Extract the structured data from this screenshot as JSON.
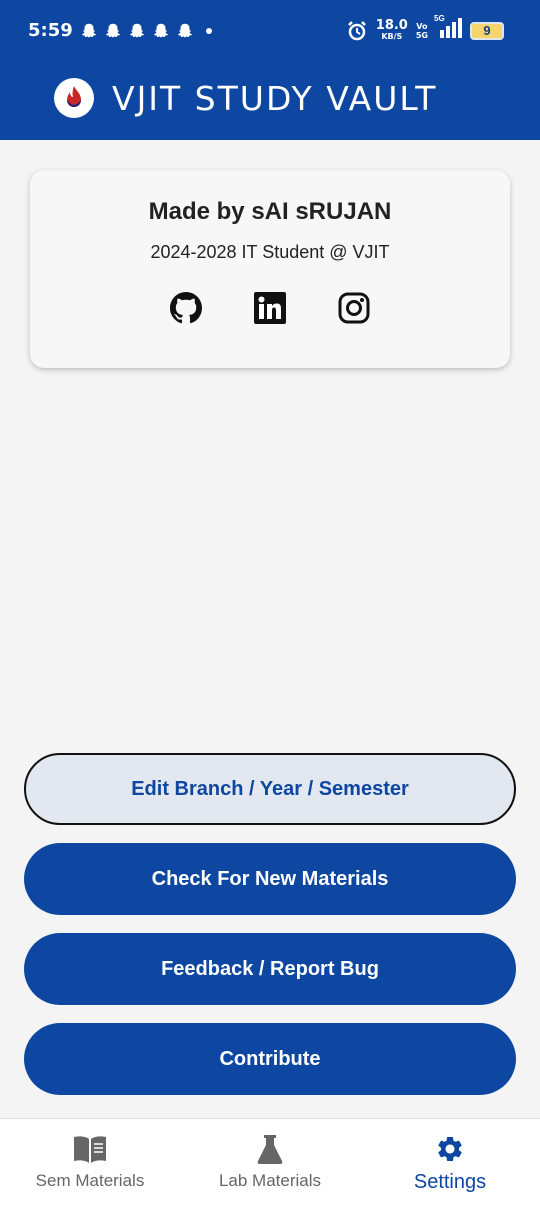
{
  "status_bar": {
    "time": "5:59",
    "net_speed": "18.0",
    "net_unit": "KB/S",
    "volte_top": "Vo",
    "volte_bottom": "5G",
    "network": "5G",
    "battery": "9"
  },
  "header": {
    "title": "VJIT STUDY VAULT",
    "color": "#0d47a1"
  },
  "profile_card": {
    "made_by": "Made by sAI sRUJAN",
    "subtitle": "2024-2028 IT Student @ VJIT",
    "socials": [
      "github-icon",
      "linkedin-icon",
      "instagram-icon"
    ]
  },
  "actions": {
    "edit": "Edit Branch / Year / Semester",
    "check": "Check For New Materials",
    "feedback": "Feedback / Report Bug",
    "contribute": "Contribute"
  },
  "bottom_nav": {
    "items": [
      {
        "label": "Sem Materials",
        "icon": "book-icon"
      },
      {
        "label": "Lab Materials",
        "icon": "flask-icon"
      },
      {
        "label": "Settings",
        "icon": "gear-icon",
        "active": true
      }
    ]
  }
}
